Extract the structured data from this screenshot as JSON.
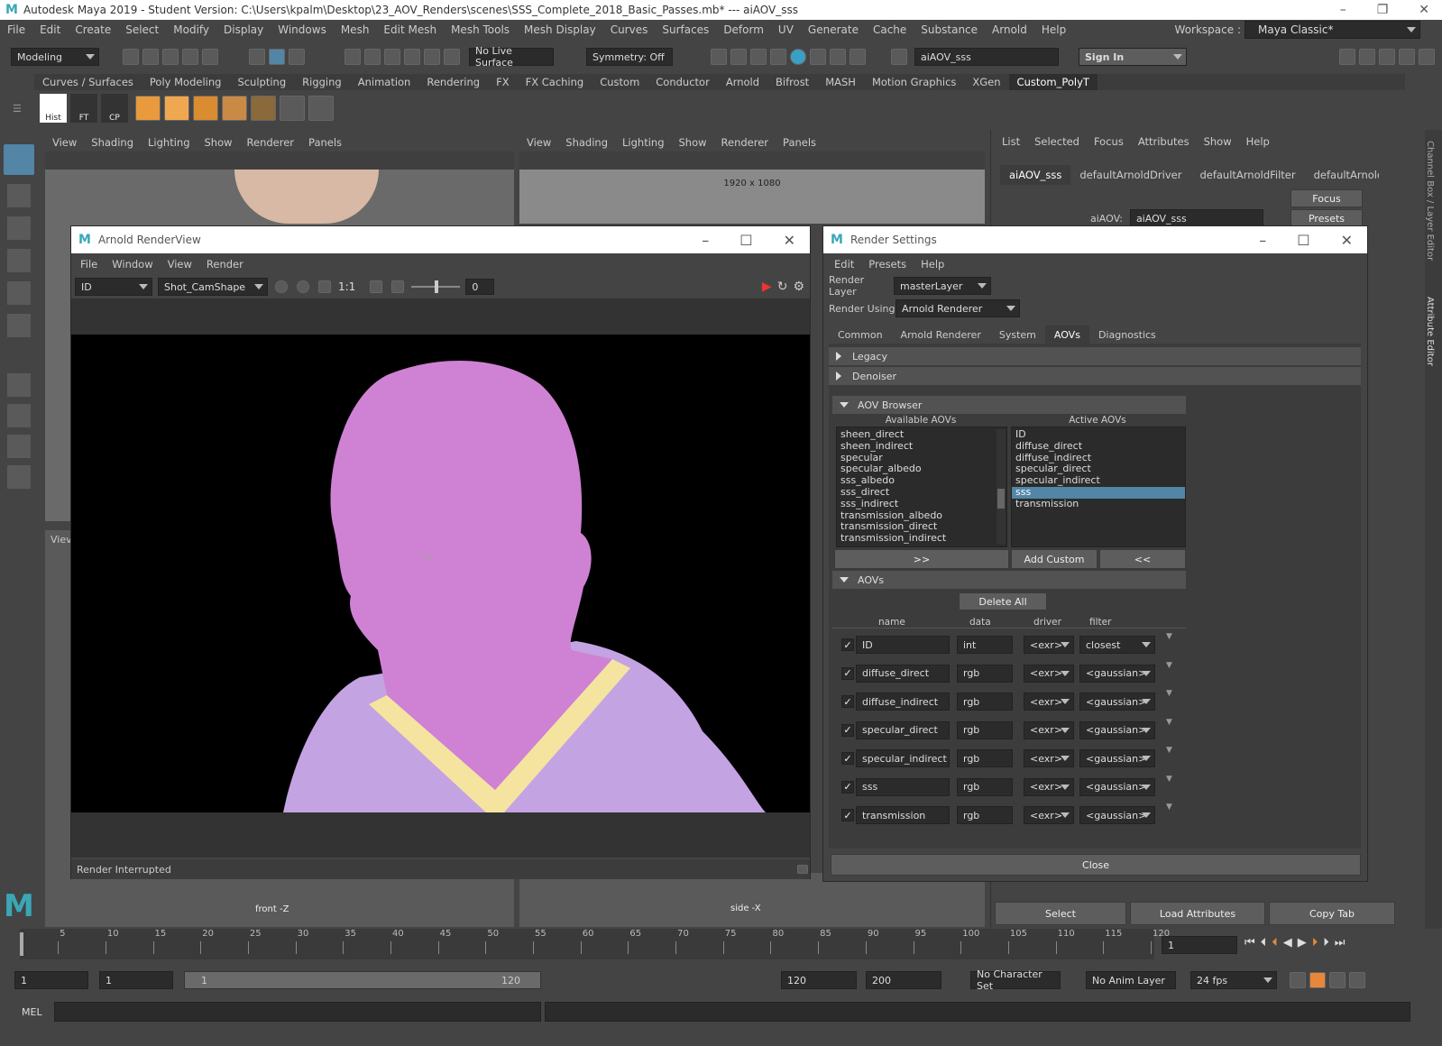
{
  "app": {
    "title": "Autodesk Maya 2019 - Student Version: C:\\Users\\kpalm\\Desktop\\23_AOV_Renders\\scenes\\SSS_Complete_2018_Basic_Passes.mb*  ---  aiAOV_sss",
    "menu": [
      "File",
      "Edit",
      "Create",
      "Select",
      "Modify",
      "Display",
      "Windows",
      "Mesh",
      "Edit Mesh",
      "Mesh Tools",
      "Mesh Display",
      "Curves",
      "Surfaces",
      "Deform",
      "UV",
      "Generate",
      "Cache",
      "Substance",
      "Arnold",
      "Help"
    ],
    "workspace_label": "Workspace :",
    "workspace_value": "Maya Classic*"
  },
  "statusline": {
    "mode": "Modeling",
    "live_surface": "No Live Surface",
    "symmetry": "Symmetry: Off",
    "node_field": "aiAOV_sss",
    "sign_in": "Sign In"
  },
  "shelf": {
    "tabs": [
      "Curves / Surfaces",
      "Poly Modeling",
      "Sculpting",
      "Rigging",
      "Animation",
      "Rendering",
      "FX",
      "FX Caching",
      "Custom",
      "Conductor",
      "Arnold",
      "Bifrost",
      "MASH",
      "Motion Graphics",
      "XGen",
      "Custom_PolyT"
    ],
    "active_tab": "Custom_PolyT",
    "buttons": [
      "Hist",
      "FT",
      "CP"
    ]
  },
  "viewport1": {
    "menu": [
      "View",
      "Shading",
      "Lighting",
      "Show",
      "Renderer",
      "Panels"
    ],
    "cam_label": "front -Z",
    "view_label": "Viev"
  },
  "viewport2": {
    "menu": [
      "View",
      "Shading",
      "Lighting",
      "Show",
      "Renderer",
      "Panels"
    ],
    "resolution": "1920 x 1080",
    "cam_label": "side -X"
  },
  "attr_editor": {
    "menu": [
      "List",
      "Selected",
      "Focus",
      "Attributes",
      "Show",
      "Help"
    ],
    "tabs": [
      "aiAOV_sss",
      "defaultArnoldDriver",
      "defaultArnoldFilter",
      "defaultArnoldR"
    ],
    "field_label": "aiAOV:",
    "field_value": "aiAOV_sss",
    "focus": "Focus",
    "presets": "Presets",
    "bottom_buttons": [
      "Select",
      "Load Attributes",
      "Copy Tab"
    ],
    "side_labels": [
      "Channel Box / Layer Editor",
      "Attribute Editor"
    ]
  },
  "renderview": {
    "title": "Arnold RenderView",
    "menu": [
      "File",
      "Window",
      "View",
      "Render"
    ],
    "aov": "ID",
    "camera": "Shot_CamShape",
    "ratio": "1:1",
    "exposure": "0",
    "status": "Render Interrupted",
    "colors": {
      "skin": "#cf82d3",
      "shirt": "#c4a3e3",
      "collar": "#f5e4a0",
      "bg": "#000000"
    }
  },
  "render_settings": {
    "title": "Render Settings",
    "menu": [
      "Edit",
      "Presets",
      "Help"
    ],
    "layer_label": "Render Layer",
    "layer_value": "masterLayer",
    "using_label": "Render Using",
    "using_value": "Arnold Renderer",
    "tabs": [
      "Common",
      "Arnold Renderer",
      "System",
      "AOVs",
      "Diagnostics"
    ],
    "active_tab": "AOVs",
    "sections": {
      "legacy": "Legacy",
      "denoiser": "Denoiser",
      "browser": "AOV Browser",
      "aovs": "AOVs"
    },
    "available_label": "Available AOVs",
    "active_label": "Active AOVs",
    "available": [
      "sheen_direct",
      "sheen_indirect",
      "specular",
      "specular_albedo",
      "sss_albedo",
      "sss_direct",
      "sss_indirect",
      "transmission_albedo",
      "transmission_direct",
      "transmission_indirect"
    ],
    "active": [
      "ID",
      "diffuse_direct",
      "diffuse_indirect",
      "specular_direct",
      "specular_indirect",
      "sss",
      "transmission"
    ],
    "active_selected": "sss",
    "btn_add": ">>",
    "btn_custom": "Add Custom",
    "btn_remove": "<<",
    "delete_all": "Delete All",
    "columns": [
      "name",
      "data",
      "driver",
      "filter"
    ],
    "rows": [
      {
        "name": "ID",
        "data": "int",
        "driver": "<exr>",
        "filter": "closest"
      },
      {
        "name": "diffuse_direct",
        "data": "rgb",
        "driver": "<exr>",
        "filter": "<gaussian>"
      },
      {
        "name": "diffuse_indirect",
        "data": "rgb",
        "driver": "<exr>",
        "filter": "<gaussian>"
      },
      {
        "name": "specular_direct",
        "data": "rgb",
        "driver": "<exr>",
        "filter": "<gaussian>"
      },
      {
        "name": "specular_indirect",
        "data": "rgb",
        "driver": "<exr>",
        "filter": "<gaussian>"
      },
      {
        "name": "sss",
        "data": "rgb",
        "driver": "<exr>",
        "filter": "<gaussian>"
      },
      {
        "name": "transmission",
        "data": "rgb",
        "driver": "<exr>",
        "filter": "<gaussian>"
      }
    ],
    "close": "Close"
  },
  "timeline": {
    "ticks": [
      "5",
      "10",
      "15",
      "20",
      "25",
      "30",
      "35",
      "40",
      "45",
      "50",
      "55",
      "60",
      "65",
      "70",
      "75",
      "80",
      "85",
      "90",
      "95",
      "100",
      "105",
      "110",
      "115",
      "120"
    ],
    "current_frame": "1",
    "start": "1",
    "start2": "1",
    "range_start": "1",
    "range_end": "120",
    "end": "120",
    "end2": "200",
    "character_set": "No Character Set",
    "anim_layer": "No Anim Layer",
    "fps": "24 fps"
  },
  "cmdline": {
    "label": "MEL"
  }
}
